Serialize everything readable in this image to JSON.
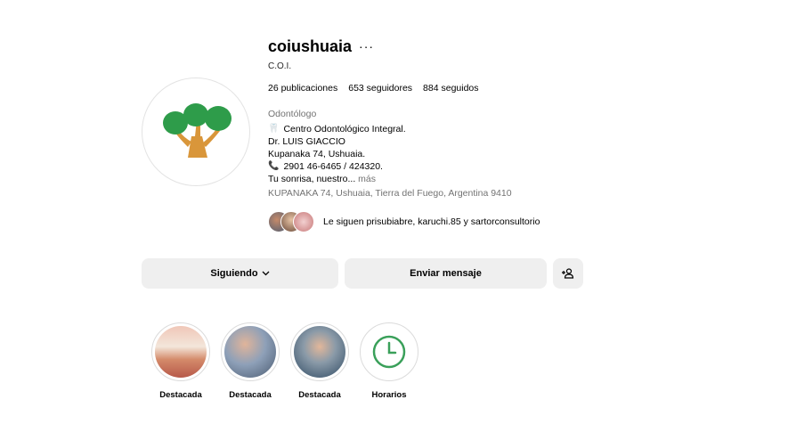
{
  "profile": {
    "username": "coiushuaia",
    "more_icon": "···",
    "full_name": "C.O.I.",
    "stats": {
      "posts": "26 publicaciones",
      "followers": "653 seguidores",
      "following": "884 seguidos"
    },
    "category": "Odontólogo",
    "bio": {
      "line1": "Centro Odontológico Integral.",
      "line2": "Dr. LUIS GIACCIO",
      "line3": "Kupanaka 74, Ushuaia.",
      "line4": "2901 46-6465 / 424320.",
      "line5": "Tu sonrisa, nuestro...",
      "more": "más"
    },
    "address": "KUPANAKA 74, Ushuaia, Tierra del Fuego, Argentina 9410",
    "followed_by": {
      "prefix": "Le siguen",
      "users": "prisubiabre, karuchi.85",
      "joiner": "y",
      "last": "sartorconsultorio"
    }
  },
  "actions": {
    "following": "Siguiendo",
    "message": "Enviar mensaje",
    "add_user_icon": "add-person"
  },
  "highlights": [
    {
      "label": "Destacada"
    },
    {
      "label": "Destacada"
    },
    {
      "label": "Destacada"
    },
    {
      "label": "Horarios"
    }
  ],
  "colors": {
    "tree_green": "#2e9c4a",
    "trunk": "#d9963a",
    "clock_green": "#3aa05a"
  }
}
